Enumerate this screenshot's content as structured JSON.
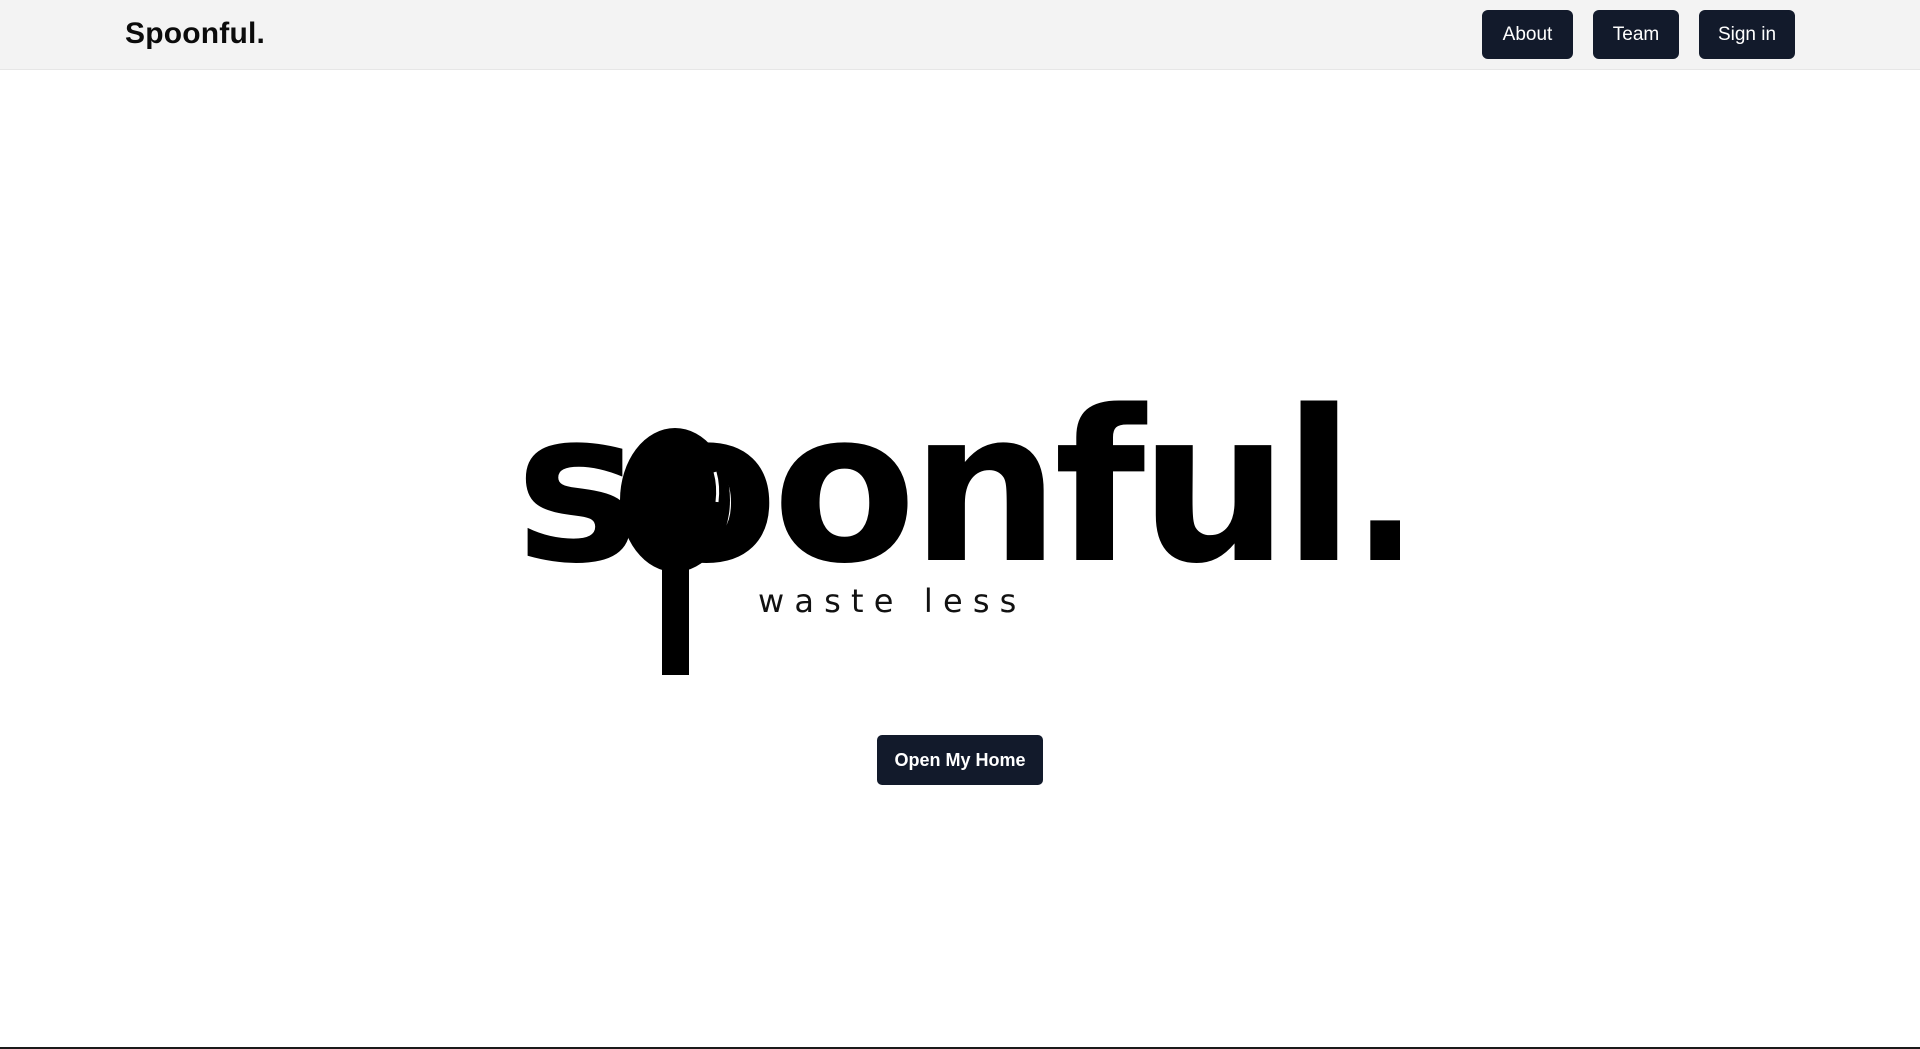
{
  "navbar": {
    "brand": "Spoonful.",
    "about_label": "About",
    "team_label": "Team",
    "signin_label": "Sign in"
  },
  "hero": {
    "logo_word": "soonful.",
    "tagline": "w a s t e   l e s s",
    "cta_label": "Open My Home"
  },
  "colors": {
    "button_bg": "#121a2b",
    "navbar_bg": "#f3f3f3",
    "logo": "#000000"
  },
  "icons": {
    "logo_spoon": "spoon-icon"
  }
}
